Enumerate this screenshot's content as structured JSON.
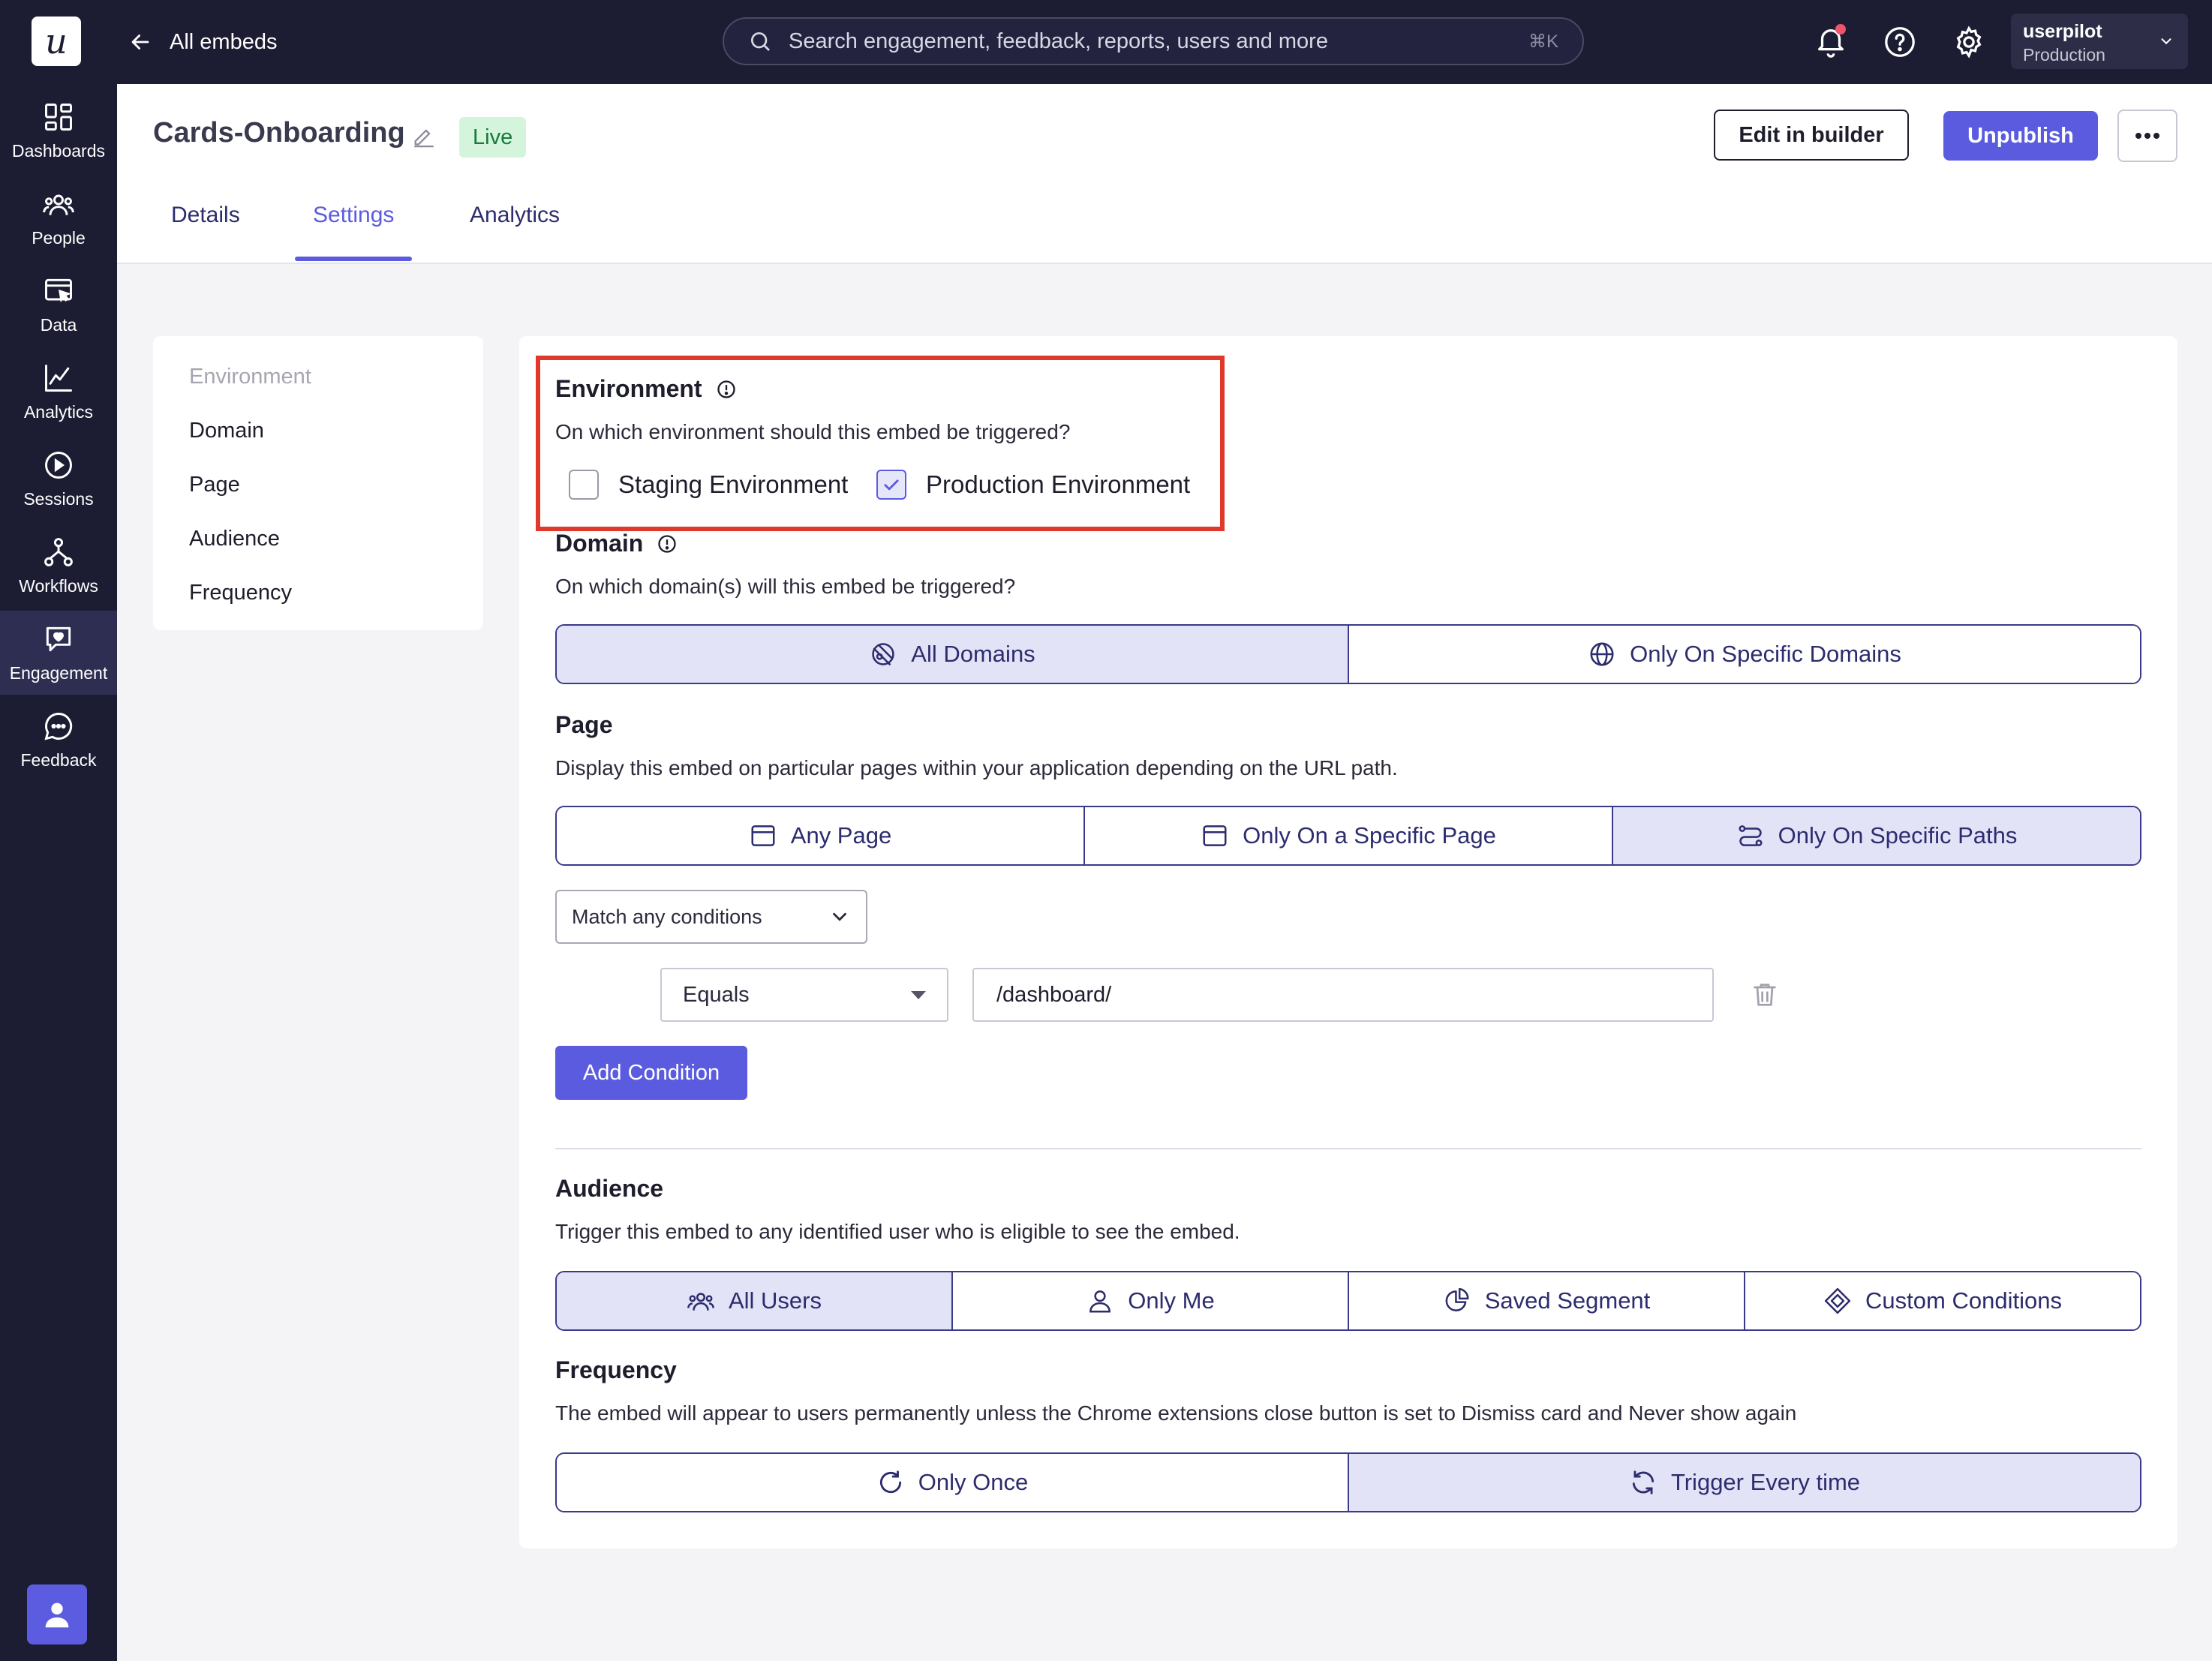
{
  "topbar": {
    "logo_letter": "u",
    "back_label": "All embeds",
    "search_placeholder": "Search engagement, feedback, reports, users and more",
    "search_shortcut": "⌘K",
    "account_name": "userpilot",
    "account_env": "Production"
  },
  "sidebar": {
    "items": [
      {
        "label": "Dashboards",
        "icon": "dashboards-icon"
      },
      {
        "label": "People",
        "icon": "people-icon"
      },
      {
        "label": "Data",
        "icon": "data-icon"
      },
      {
        "label": "Analytics",
        "icon": "analytics-icon"
      },
      {
        "label": "Sessions",
        "icon": "sessions-icon"
      },
      {
        "label": "Workflows",
        "icon": "workflows-icon"
      },
      {
        "label": "Engagement",
        "icon": "engagement-icon",
        "active": true
      },
      {
        "label": "Feedback",
        "icon": "feedback-icon"
      }
    ]
  },
  "header": {
    "title": "Cards-Onboarding",
    "status": "Live",
    "edit_builder_label": "Edit in builder",
    "unpublish_label": "Unpublish",
    "tabs": [
      {
        "label": "Details"
      },
      {
        "label": "Settings",
        "active": true
      },
      {
        "label": "Analytics"
      }
    ]
  },
  "settings_menu": {
    "items": [
      {
        "label": "Environment",
        "muted": true
      },
      {
        "label": "Domain"
      },
      {
        "label": "Page"
      },
      {
        "label": "Audience"
      },
      {
        "label": "Frequency"
      }
    ]
  },
  "environment": {
    "title": "Environment",
    "description": "On which environment should this embed be triggered?",
    "options": [
      {
        "label": "Staging Environment",
        "checked": false
      },
      {
        "label": "Production Environment",
        "checked": true
      }
    ]
  },
  "domain": {
    "title": "Domain",
    "description": "On which domain(s) will this embed be triggered?",
    "options": [
      {
        "label": "All Domains",
        "selected": true
      },
      {
        "label": "Only On Specific Domains",
        "selected": false
      }
    ]
  },
  "page": {
    "title": "Page",
    "description": "Display this embed on particular pages within your application depending on the URL path.",
    "options": [
      {
        "label": "Any Page",
        "selected": false
      },
      {
        "label": "Only On a Specific Page",
        "selected": false
      },
      {
        "label": "Only On Specific Paths",
        "selected": true
      }
    ],
    "match_select": "Match any conditions",
    "condition_operator": "Equals",
    "condition_value": "/dashboard/",
    "add_condition_label": "Add Condition"
  },
  "audience": {
    "title": "Audience",
    "description": "Trigger this embed to any identified user who is eligible to see the embed.",
    "options": [
      {
        "label": "All Users",
        "selected": true
      },
      {
        "label": "Only Me",
        "selected": false
      },
      {
        "label": "Saved Segment",
        "selected": false
      },
      {
        "label": "Custom Conditions",
        "selected": false
      }
    ]
  },
  "frequency": {
    "title": "Frequency",
    "description": "The embed will appear to users permanently unless the Chrome extensions close button is set to Dismiss card and Never show again",
    "options": [
      {
        "label": "Only Once",
        "selected": false
      },
      {
        "label": "Trigger Every time",
        "selected": true
      }
    ]
  },
  "colors": {
    "sidebar_bg": "#1c1c33",
    "accent": "#5b5be0",
    "selected_segment": "#e3e3f8",
    "highlight_border": "#e0392b",
    "live_badge_bg": "#d4f5dc"
  }
}
